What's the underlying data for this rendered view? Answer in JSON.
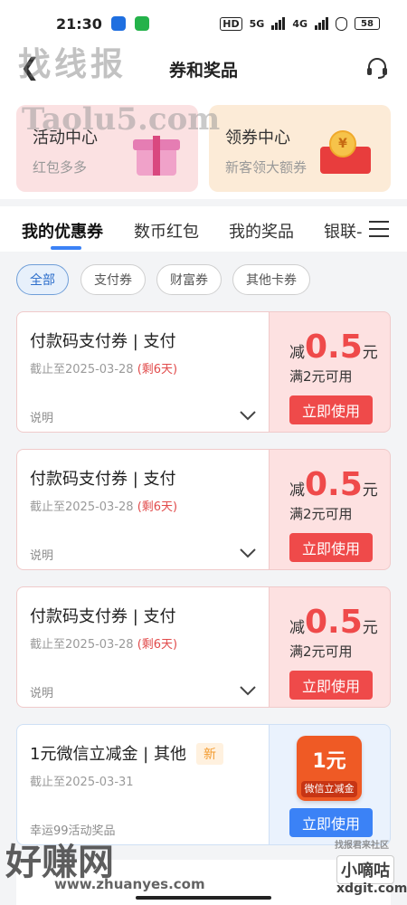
{
  "status_bar": {
    "time": "21:30",
    "network": "5G",
    "network2": "4G",
    "battery": "58",
    "hd": "HD"
  },
  "header": {
    "title": "券和奖品"
  },
  "watermarks": {
    "top_logo": "找线报",
    "top_url": "Taolu5.com",
    "bottom_logo": "好赚网",
    "bottom_url": "www.zhuanyes.com",
    "right_logo": "小嘀咕",
    "right_small": "找报君来社区",
    "right_url": "xdgit.com"
  },
  "banners": [
    {
      "title": "活动中心",
      "subtitle": "红包多多",
      "icon": "gift-icon"
    },
    {
      "title": "领券中心",
      "subtitle": "新客领大额券",
      "icon": "envelope-coin-icon"
    }
  ],
  "tabs": [
    "我的优惠券",
    "数币红包",
    "我的奖品",
    "银联-"
  ],
  "filters": [
    "全部",
    "支付券",
    "财富券",
    "其他卡券"
  ],
  "coupons": [
    {
      "title": "付款码支付券 | 支付",
      "deadline": "截止至2025-03-28",
      "remaining": "(剩6天)",
      "desc": "说明",
      "amount_prefix": "减",
      "amount": "0.5",
      "unit": "元",
      "condition": "满2元可用",
      "button": "立即使用"
    },
    {
      "title": "付款码支付券 | 支付",
      "deadline": "截止至2025-03-28",
      "remaining": "(剩6天)",
      "desc": "说明",
      "amount_prefix": "减",
      "amount": "0.5",
      "unit": "元",
      "condition": "满2元可用",
      "button": "立即使用"
    },
    {
      "title": "付款码支付券 | 支付",
      "deadline": "截止至2025-03-28",
      "remaining": "(剩6天)",
      "desc": "说明",
      "amount_prefix": "减",
      "amount": "0.5",
      "unit": "元",
      "condition": "满2元可用",
      "button": "立即使用"
    },
    {
      "title": "1元微信立减金 | 其他",
      "badge": "新",
      "deadline": "截止至2025-03-31",
      "desc": "幸运99活动奖品",
      "voucher_big": "1元",
      "voucher_small": "微信立减金",
      "button": "立即使用"
    }
  ],
  "colors": {
    "accent_blue": "#3b82f6",
    "coupon_red": "#ef4a4a",
    "coupon_pink_bg": "#fde1e1"
  }
}
